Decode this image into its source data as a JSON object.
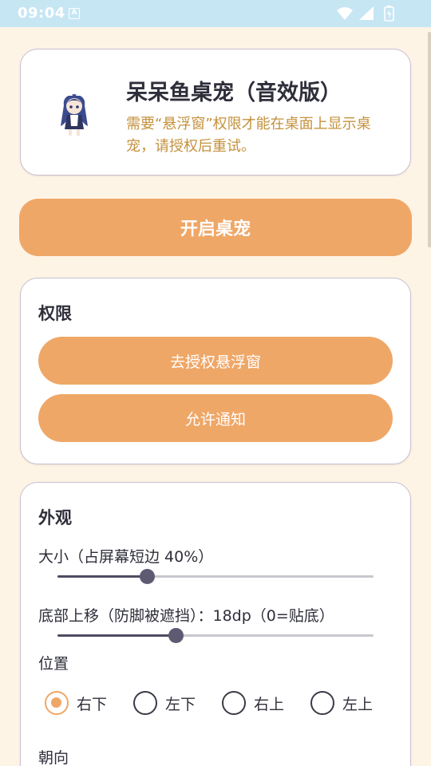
{
  "status_bar": {
    "time": "09:04",
    "notification_icon": "a-icon",
    "icons": [
      "wifi-icon",
      "signal-icon",
      "battery-icon"
    ]
  },
  "header": {
    "title": "呆呆鱼桌宠（音效版）",
    "description": "需要“悬浮窗”权限才能在桌面上显示桌宠，请授权后重试。",
    "avatar_icon": "pet-avatar-icon"
  },
  "start_button": {
    "label": "开启桌宠"
  },
  "permissions": {
    "title": "权限",
    "overlay_button": "去授权悬浮窗",
    "notify_button": "允许通知"
  },
  "appearance": {
    "title": "外观",
    "size": {
      "label": "大小（占屏幕短边 40%）",
      "value_fraction": 0.285
    },
    "offset": {
      "label": "底部上移（防脚被遮挡）：18dp（0=贴底）",
      "value_fraction": 0.375
    },
    "position": {
      "label": "位置",
      "options": [
        "右下",
        "左下",
        "右上",
        "左上"
      ],
      "selected": "右下"
    },
    "orientation_label": "朝向"
  },
  "colors": {
    "accent": "#EFA767",
    "background": "#FEF4E6",
    "desc_text": "#C4913C",
    "status_bar": "#C7E6F4"
  }
}
